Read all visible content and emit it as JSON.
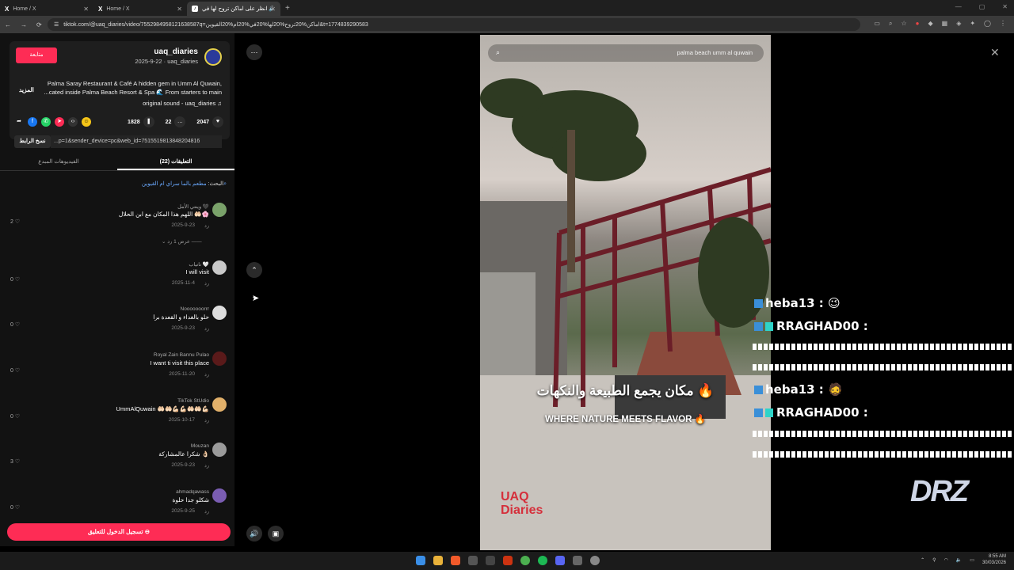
{
  "browser": {
    "tabs": [
      {
        "label": "Home / X",
        "icon": "x-logo"
      },
      {
        "label": "Home / X",
        "icon": "x-logo"
      },
      {
        "label": "انظر على اماكن تروح لها في 🔊",
        "icon": "tiktok-logo"
      }
    ],
    "new_tab": "+",
    "url": "tiktok.com/@uaq_diaries/video/7552984958121638587q=اماكن%20تروح%20لها%20في%20ام%20القيوين&t=1774839290583"
  },
  "post": {
    "follow_label": "متابعة",
    "username": "uaq_diaries",
    "subline": "2025-9-22 · uaq_diaries",
    "description": "Palma Saray Restaurant & Café A hidden gem in Umm Al Quwain, ...cated inside Palma Beach Resort & Spa 🌊 From starters to main",
    "more_label": "المزيد",
    "sound": "original sound - uaq_diaries ♫",
    "likes": "2047",
    "comments": "22",
    "saves": "1828",
    "copy_link_label": "نسخ الرابط",
    "link_text": "...p=1&sender_device=pc&web_id=7515519813848204816"
  },
  "panel_tabs": {
    "comments": "التعليقات (22)",
    "creator_videos": "الفيديوهات المبدع"
  },
  "search_suggest": {
    "prefix": "البحث: ",
    "query": "مطعم بالما سراي ام القيوين"
  },
  "comments": [
    {
      "name": "وينتي الأمل 🖤",
      "text": "اللهم هذا المكان مع ابن الحلال 🤲🏻🌸",
      "date": "2025-9-23",
      "reply": "رد",
      "likes": "2",
      "color": "#7aa26a"
    },
    {
      "name": "نانياب 🤍",
      "text": "I will visit",
      "date": "2025-11-4",
      "reply": "رد",
      "likes": "0",
      "color": "#c9c9c9"
    },
    {
      "name": "Nooooooorrr",
      "text": "حلو بالغداء و القعدة برا",
      "date": "2025-9-23",
      "reply": "رد",
      "likes": "0",
      "color": "#dddddd"
    },
    {
      "name": "Royal Zain Bannu Pulao",
      "text": "I want ti visit this place",
      "date": "2025-11-20",
      "reply": "رد",
      "likes": "0",
      "color": "#5a1a1a"
    },
    {
      "name": "TikTok StUdio",
      "text": "UmmAlQuwain 🤲🏻🤲🏻💪🏻💪🏻🤲🏻🤲🏻💪🏻",
      "date": "2025-10-17",
      "reply": "رد",
      "likes": "0",
      "color": "#e1b06a"
    },
    {
      "name": "Mouzan",
      "text": "شكرا عالمشاركة 👌🏻",
      "date": "2025-9-23",
      "reply": "رد",
      "likes": "3",
      "color": "#9b9b9b"
    },
    {
      "name": "ahmadqawass",
      "text": "شكلو جدا حلوة",
      "date": "2025-9-25",
      "reply": "رد",
      "likes": "0",
      "color": "#7a5db2"
    }
  ],
  "view_replies": "عرض 1 رد",
  "login_label": "تسجيل الدخول للتعليق",
  "video": {
    "search_query": "palma beach umm al quwain",
    "caption_ar": "مكان يجمع الطبيعة والنكهات 🔥",
    "caption_en": "WHERE NATURE MEETS FLAVOR 🔥",
    "watermark_line1": "UAQ",
    "watermark_line2": "Diaries"
  },
  "chat": [
    {
      "user": "heba13 :",
      "emote": "😉"
    },
    {
      "user": "RRAGHAD00 :"
    },
    {
      "user": "heba13 :",
      "emote": "🧔"
    },
    {
      "user": "RRAGHAD00 :"
    }
  ],
  "stream_logo": "DRZ",
  "taskbar": {
    "time": "8:55 AM",
    "date": "30/03/2026"
  },
  "colors": {
    "accent": "#fe2c55",
    "link": "#6aa9ff"
  }
}
